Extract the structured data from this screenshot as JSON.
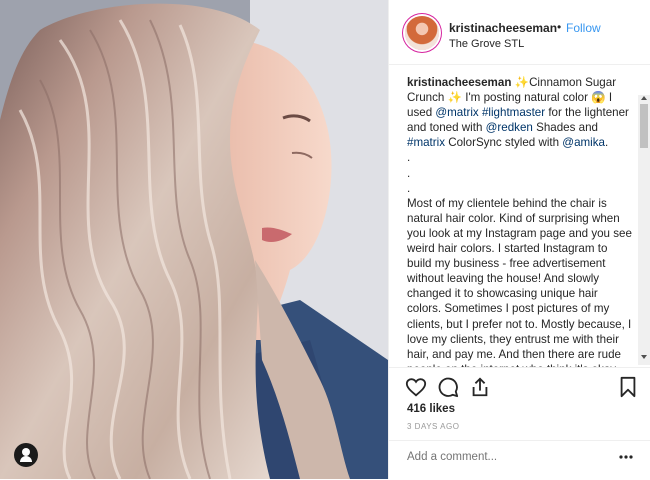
{
  "post": {
    "username": "kristinacheeseman",
    "separator": "•",
    "follow_label": "Follow",
    "location": "The Grove STL"
  },
  "caption": {
    "author": "kristinacheeseman",
    "line1_a": " ✨Cinnamon Sugar Crunch ✨ I'm posting natural color 😱 I used ",
    "mention_matrix": "@matrix",
    "space1": " ",
    "hashtag_lightmaster": "#lightmaster",
    "line1_b": " for the lightener and toned with ",
    "mention_redken": "@redken",
    "line1_c": " Shades and ",
    "hashtag_matrix": "#matrix",
    "line1_d": " ColorSync styled with ",
    "mention_amika": "@amika",
    "line1_e": ".\n.\n.\n.\nMost of my clientele behind the chair is natural hair color. Kind of surprising when you look at my Instagram page and you see weird hair colors. I started Instagram to build my business - free advertisement without leaving the house! And slowly changed it to showcasing unique hair colors. Sometimes I post pictures of my clients, but I prefer not to. Mostly because, I love my clients, they entrust me with their hair, and pay me. And then there are rude people on the internet who think it's okay"
  },
  "stats": {
    "likes": "416 likes",
    "time": "3 DAYS AGO"
  },
  "comment": {
    "placeholder": "Add a comment..."
  },
  "icons": {
    "like": "heart-icon",
    "comment": "comment-icon",
    "share": "share-icon",
    "save": "bookmark-icon",
    "more": "more-icon",
    "tag": "user-tag-icon"
  },
  "colors": {
    "follow": "#3897f0",
    "link": "#003569",
    "muted": "#999999",
    "text": "#262626"
  }
}
